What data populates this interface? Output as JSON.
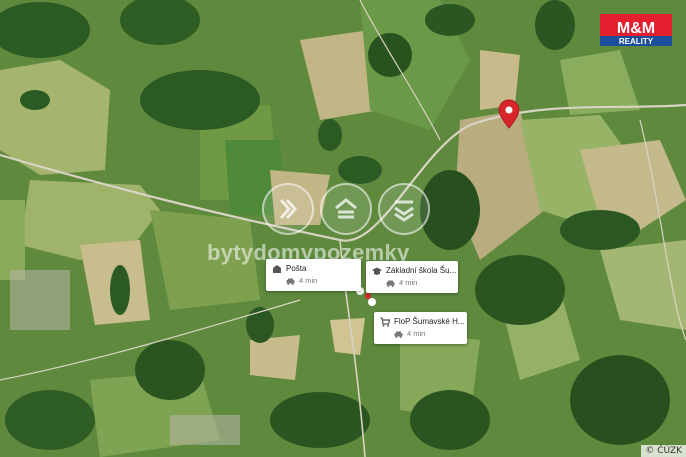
{
  "watermark": {
    "text": "bytydomypozemky"
  },
  "logo": {
    "text_top": "M&M",
    "text_bottom": "REALITY",
    "color": "#e4202e"
  },
  "pin": {
    "color": "#d9262b",
    "icon": "location-pin-icon"
  },
  "pois": [
    {
      "name": "Pošta",
      "time": "4 min",
      "icon": "post-office-icon"
    },
    {
      "name": "Základní škola Šu...",
      "time": "4 min",
      "icon": "school-icon"
    },
    {
      "name": "FloP Šumavské H...",
      "time": "4 min",
      "icon": "shop-icon"
    }
  ],
  "travel_icon": "car-icon",
  "copyright": "© ČÚZK"
}
